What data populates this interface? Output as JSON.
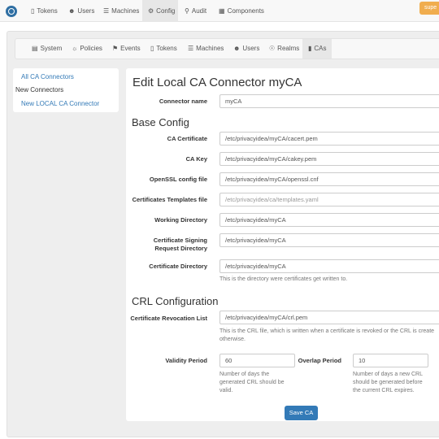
{
  "topnav": {
    "items": [
      {
        "label": "Tokens",
        "icon": "phone-icon"
      },
      {
        "label": "Users",
        "icon": "user-icon"
      },
      {
        "label": "Machines",
        "icon": "list-icon"
      },
      {
        "label": "Config",
        "icon": "cog-icon"
      },
      {
        "label": "Audit",
        "icon": "search-icon"
      },
      {
        "label": "Components",
        "icon": "grid-icon"
      }
    ],
    "active": "Config",
    "user_button": "supe"
  },
  "subnav": {
    "items": [
      {
        "label": "System",
        "icon": "server-icon"
      },
      {
        "label": "Policies",
        "icon": "bulb-icon"
      },
      {
        "label": "Events",
        "icon": "flag-icon"
      },
      {
        "label": "Tokens",
        "icon": "phone-icon"
      },
      {
        "label": "Machines",
        "icon": "list-icon"
      },
      {
        "label": "Users",
        "icon": "user-icon"
      },
      {
        "label": "Realms",
        "icon": "globe-icon"
      },
      {
        "label": "CAs",
        "icon": "bookmark-icon"
      }
    ],
    "active": "CAs"
  },
  "sidebar": {
    "all_connectors": "All CA Connectors",
    "new_heading": "New Connectors",
    "new_local": "New LOCAL CA Connector"
  },
  "form": {
    "title": "Edit Local CA Connector myCA",
    "connector_name": {
      "label": "Connector name",
      "value": "myCA"
    },
    "base_config_heading": "Base Config",
    "ca_certificate": {
      "label": "CA Certificate",
      "value": "/etc/privacyidea/myCA/cacert.pem"
    },
    "ca_key": {
      "label": "CA Key",
      "value": "/etc/privacyidea/myCA/cakey.pem"
    },
    "openssl_config": {
      "label": "OpenSSL config file",
      "value": "/etc/privacyidea/myCA/openssl.cnf"
    },
    "templates_file": {
      "label": "Certificates Templates file",
      "placeholder": "/etc/privacyidea/ca/templates.yaml"
    },
    "working_dir": {
      "label": "Working Directory",
      "value": "/etc/privacyidea/myCA"
    },
    "csr_dir": {
      "label_line1": "Certificate Signing",
      "label_line2": "Request Directory",
      "value": "/etc/privacyidea/myCA"
    },
    "cert_dir": {
      "label": "Certificate Directory",
      "value": "/etc/privacyidea/myCA",
      "help": "This is the directory were certificates get written to."
    },
    "crl_heading": "CRL Configuration",
    "crl_list": {
      "label": "Certificate Revocation List",
      "value": "/etc/privacyidea/myCA/crl.pem",
      "help_line1": "This is the CRL file, which is written when a certificate is revoked or the CRL is create",
      "help_line2": "otherwise."
    },
    "validity": {
      "label": "Validity Period",
      "value": "60",
      "help_line1": "Number of days the",
      "help_line2": "generated CRL should be",
      "help_line3": "valid."
    },
    "overlap": {
      "label": "Overlap Period",
      "value": "10",
      "help_line1": "Number of days a new CRL",
      "help_line2": "should be generated before",
      "help_line3": "the current CRL expires."
    },
    "save_label": "Save CA"
  }
}
